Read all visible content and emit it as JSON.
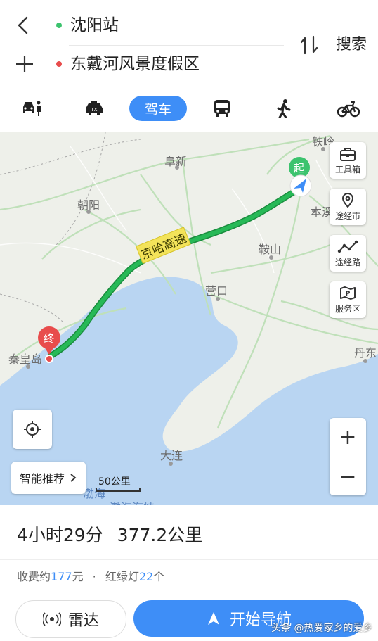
{
  "route": {
    "origin": "沈阳站",
    "destination": "东戴河风景度假区",
    "search_label": "搜索"
  },
  "modes": [
    {
      "name": "taxi-pickup",
      "icon": "car-person-icon"
    },
    {
      "name": "taxi",
      "icon": "taxi-icon"
    },
    {
      "name": "drive",
      "label": "驾车",
      "selected": true
    },
    {
      "name": "bus",
      "icon": "bus-icon"
    },
    {
      "name": "walk",
      "icon": "walk-icon"
    },
    {
      "name": "bike",
      "icon": "bike-icon"
    }
  ],
  "map": {
    "cities": {
      "tieling": "铁岭",
      "fuxin": "阜新",
      "chaoyang": "朝阳",
      "benxi": "本溪",
      "anshan": "鞍山",
      "yingkou": "营口",
      "qinhuangdao": "秦皇岛",
      "dandong": "丹东",
      "dalian": "大连",
      "bohai": "渤海",
      "bohai_strait": "渤海海峡"
    },
    "highway_label": "京哈高速",
    "start_marker": "起",
    "end_marker": "终",
    "scale": "50公里",
    "tools": {
      "toolbox": "工具箱",
      "via_city": "途经市",
      "via_road": "途经路",
      "service_area": "服务区"
    },
    "recommend_label": "智能推荐",
    "zoom_in": "+",
    "zoom_out": "−"
  },
  "summary": {
    "duration": "4小时29分",
    "distance": "377.2公里",
    "toll_prefix": "收费约",
    "toll_value": "177",
    "toll_suffix": "元",
    "separator": "·",
    "lights_prefix": "红绿灯",
    "lights_value": "22",
    "lights_suffix": "个"
  },
  "actions": {
    "radar": "雷达",
    "navigate": "开始导航"
  },
  "watermark": "头条 @热爱家乡的爱乡",
  "colors": {
    "accent": "#3e8ef7",
    "route": "#27b957",
    "start": "#3cc36e",
    "end": "#e84c4c",
    "sea": "#b9d5f2"
  }
}
